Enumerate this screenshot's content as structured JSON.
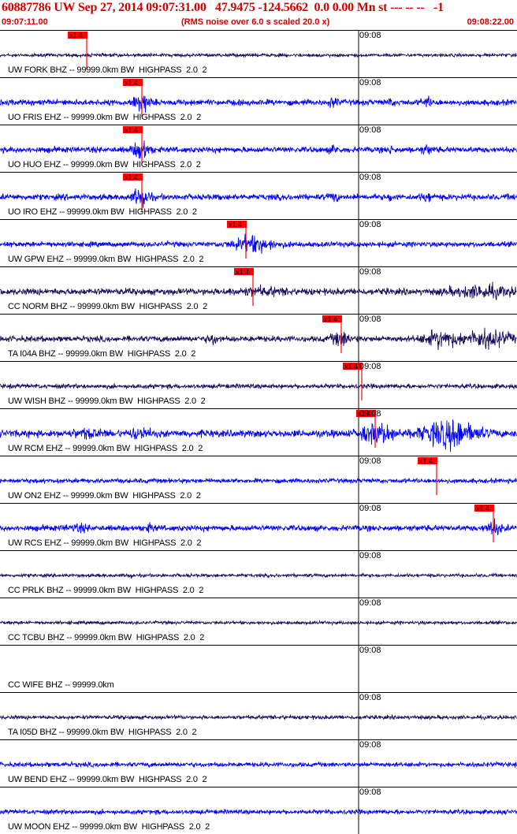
{
  "header": {
    "title": "60887786 UW Sep 27, 2014 09:07:31.00   47.9475 -124.5662  0.0 0.00 Mn st --- -- --   -1",
    "start_time": "09:07:11.00",
    "note": "(RMS noise over 6.0 s scaled 20.0 x)",
    "end_time": "09:08:22.00"
  },
  "colors": {
    "title": "#d40000",
    "pick": "#ff0000",
    "trace_blue": "#0000ff",
    "trace_dark": "#1a0a5a",
    "grid": "#000000"
  },
  "time_marker": "09:08",
  "pick_label": "x1.4",
  "traces": [
    {
      "label": "UW FORK BHZ -- 99999.0km BW  HIGHPASS  2.0  2",
      "color": "dark",
      "amp": 0.25,
      "pick": 0.168
    },
    {
      "label": "UO FRIS EHZ -- 99999.0km BW  HIGHPASS  2.0  2",
      "color": "blue",
      "amp": 0.45,
      "pick": 0.275,
      "bursts": [
        [
          0.273,
          0.015,
          4.0
        ],
        [
          0.645,
          0.008,
          2.2
        ],
        [
          0.755,
          0.006,
          1.8
        ],
        [
          0.825,
          0.01,
          2.2
        ]
      ]
    },
    {
      "label": "UO HUO EHZ -- 99999.0km BW  HIGHPASS  2.0  2",
      "color": "blue",
      "amp": 0.45,
      "pick": 0.275,
      "bursts": [
        [
          0.273,
          0.015,
          4.0
        ],
        [
          0.645,
          0.008,
          2.2
        ],
        [
          0.755,
          0.006,
          1.8
        ],
        [
          0.825,
          0.01,
          2.2
        ]
      ]
    },
    {
      "label": "UO IRO EHZ -- 99999.0km BW  HIGHPASS  2.0  2",
      "color": "blue",
      "amp": 0.45,
      "pick": 0.275,
      "bursts": [
        [
          0.273,
          0.015,
          4.0
        ],
        [
          0.645,
          0.008,
          2.2
        ],
        [
          0.755,
          0.006,
          1.8
        ],
        [
          0.825,
          0.01,
          2.2
        ]
      ]
    },
    {
      "label": "UW GPW EHZ -- 99999.0km BW  HIGHPASS  2.0  2",
      "color": "blue",
      "amp": 0.4,
      "pick": 0.475,
      "bursts": [
        [
          0.49,
          0.04,
          3.5
        ]
      ]
    },
    {
      "label": "CC NORM BHZ -- 99999.0km BW  HIGHPASS  2.0  2",
      "color": "dark",
      "amp": 0.5,
      "pick": 0.49,
      "bursts": [
        [
          0.5,
          0.05,
          1.8
        ],
        [
          0.93,
          0.06,
          2.4
        ]
      ]
    },
    {
      "label": "TA I04A BHZ -- 99999.0km BW  HIGHPASS  2.0  2",
      "color": "dark",
      "amp": 0.45,
      "pick": 0.66,
      "bursts": [
        [
          0.41,
          0.01,
          2.5
        ],
        [
          0.66,
          0.02,
          3.0
        ],
        [
          0.85,
          0.03,
          3.5
        ],
        [
          0.94,
          0.05,
          3.5
        ]
      ]
    },
    {
      "label": "UW WISH BHZ -- 99999.0km BW  HIGHPASS  2.0  2",
      "color": "dark",
      "amp": 0.35,
      "pick": 0.7
    },
    {
      "label": "UW RCM EHZ -- 99999.0km BW  HIGHPASS  2.0  2",
      "color": "blue",
      "amp": 0.55,
      "pick": 0.725,
      "bursts": [
        [
          0.17,
          0.03,
          1.8
        ],
        [
          0.27,
          0.02,
          2.2
        ],
        [
          0.73,
          0.03,
          3.5
        ],
        [
          0.87,
          0.05,
          4.5
        ]
      ]
    },
    {
      "label": "UW ON2 EHZ -- 99999.0km BW  HIGHPASS  2.0  2",
      "color": "blue",
      "amp": 0.35,
      "pick": 0.845
    },
    {
      "label": "UW RCS EHZ -- 99999.0km BW  HIGHPASS  2.0  2",
      "color": "blue",
      "amp": 0.45,
      "pick": 0.955,
      "bursts": [
        [
          0.15,
          0.02,
          1.8
        ],
        [
          0.29,
          0.01,
          1.8
        ],
        [
          0.955,
          0.015,
          3.0
        ]
      ]
    },
    {
      "label": "CC PRLK BHZ -- 99999.0km BW  HIGHPASS  2.0  2",
      "color": "dark",
      "amp": 0.25,
      "bursts": [
        [
          0.25,
          0.005,
          2.5
        ]
      ]
    },
    {
      "label": "CC TCBU BHZ -- 99999.0km BW  HIGHPASS  2.0  2",
      "color": "dark",
      "amp": 0.25
    },
    {
      "label": "CC WIFE BHZ -- 99999.0km",
      "color": "none",
      "amp": 0
    },
    {
      "label": "TA I05D BHZ -- 99999.0km BW  HIGHPASS  2.0  2",
      "color": "dark",
      "amp": 0.3
    },
    {
      "label": "UW BEND EHZ -- 99999.0km BW  HIGHPASS  2.0  2",
      "color": "blue",
      "amp": 0.35
    },
    {
      "label": "UW MOON EHZ -- 99999.0km BW  HIGHPASS  2.0  2",
      "color": "blue",
      "amp": 0.35
    }
  ]
}
